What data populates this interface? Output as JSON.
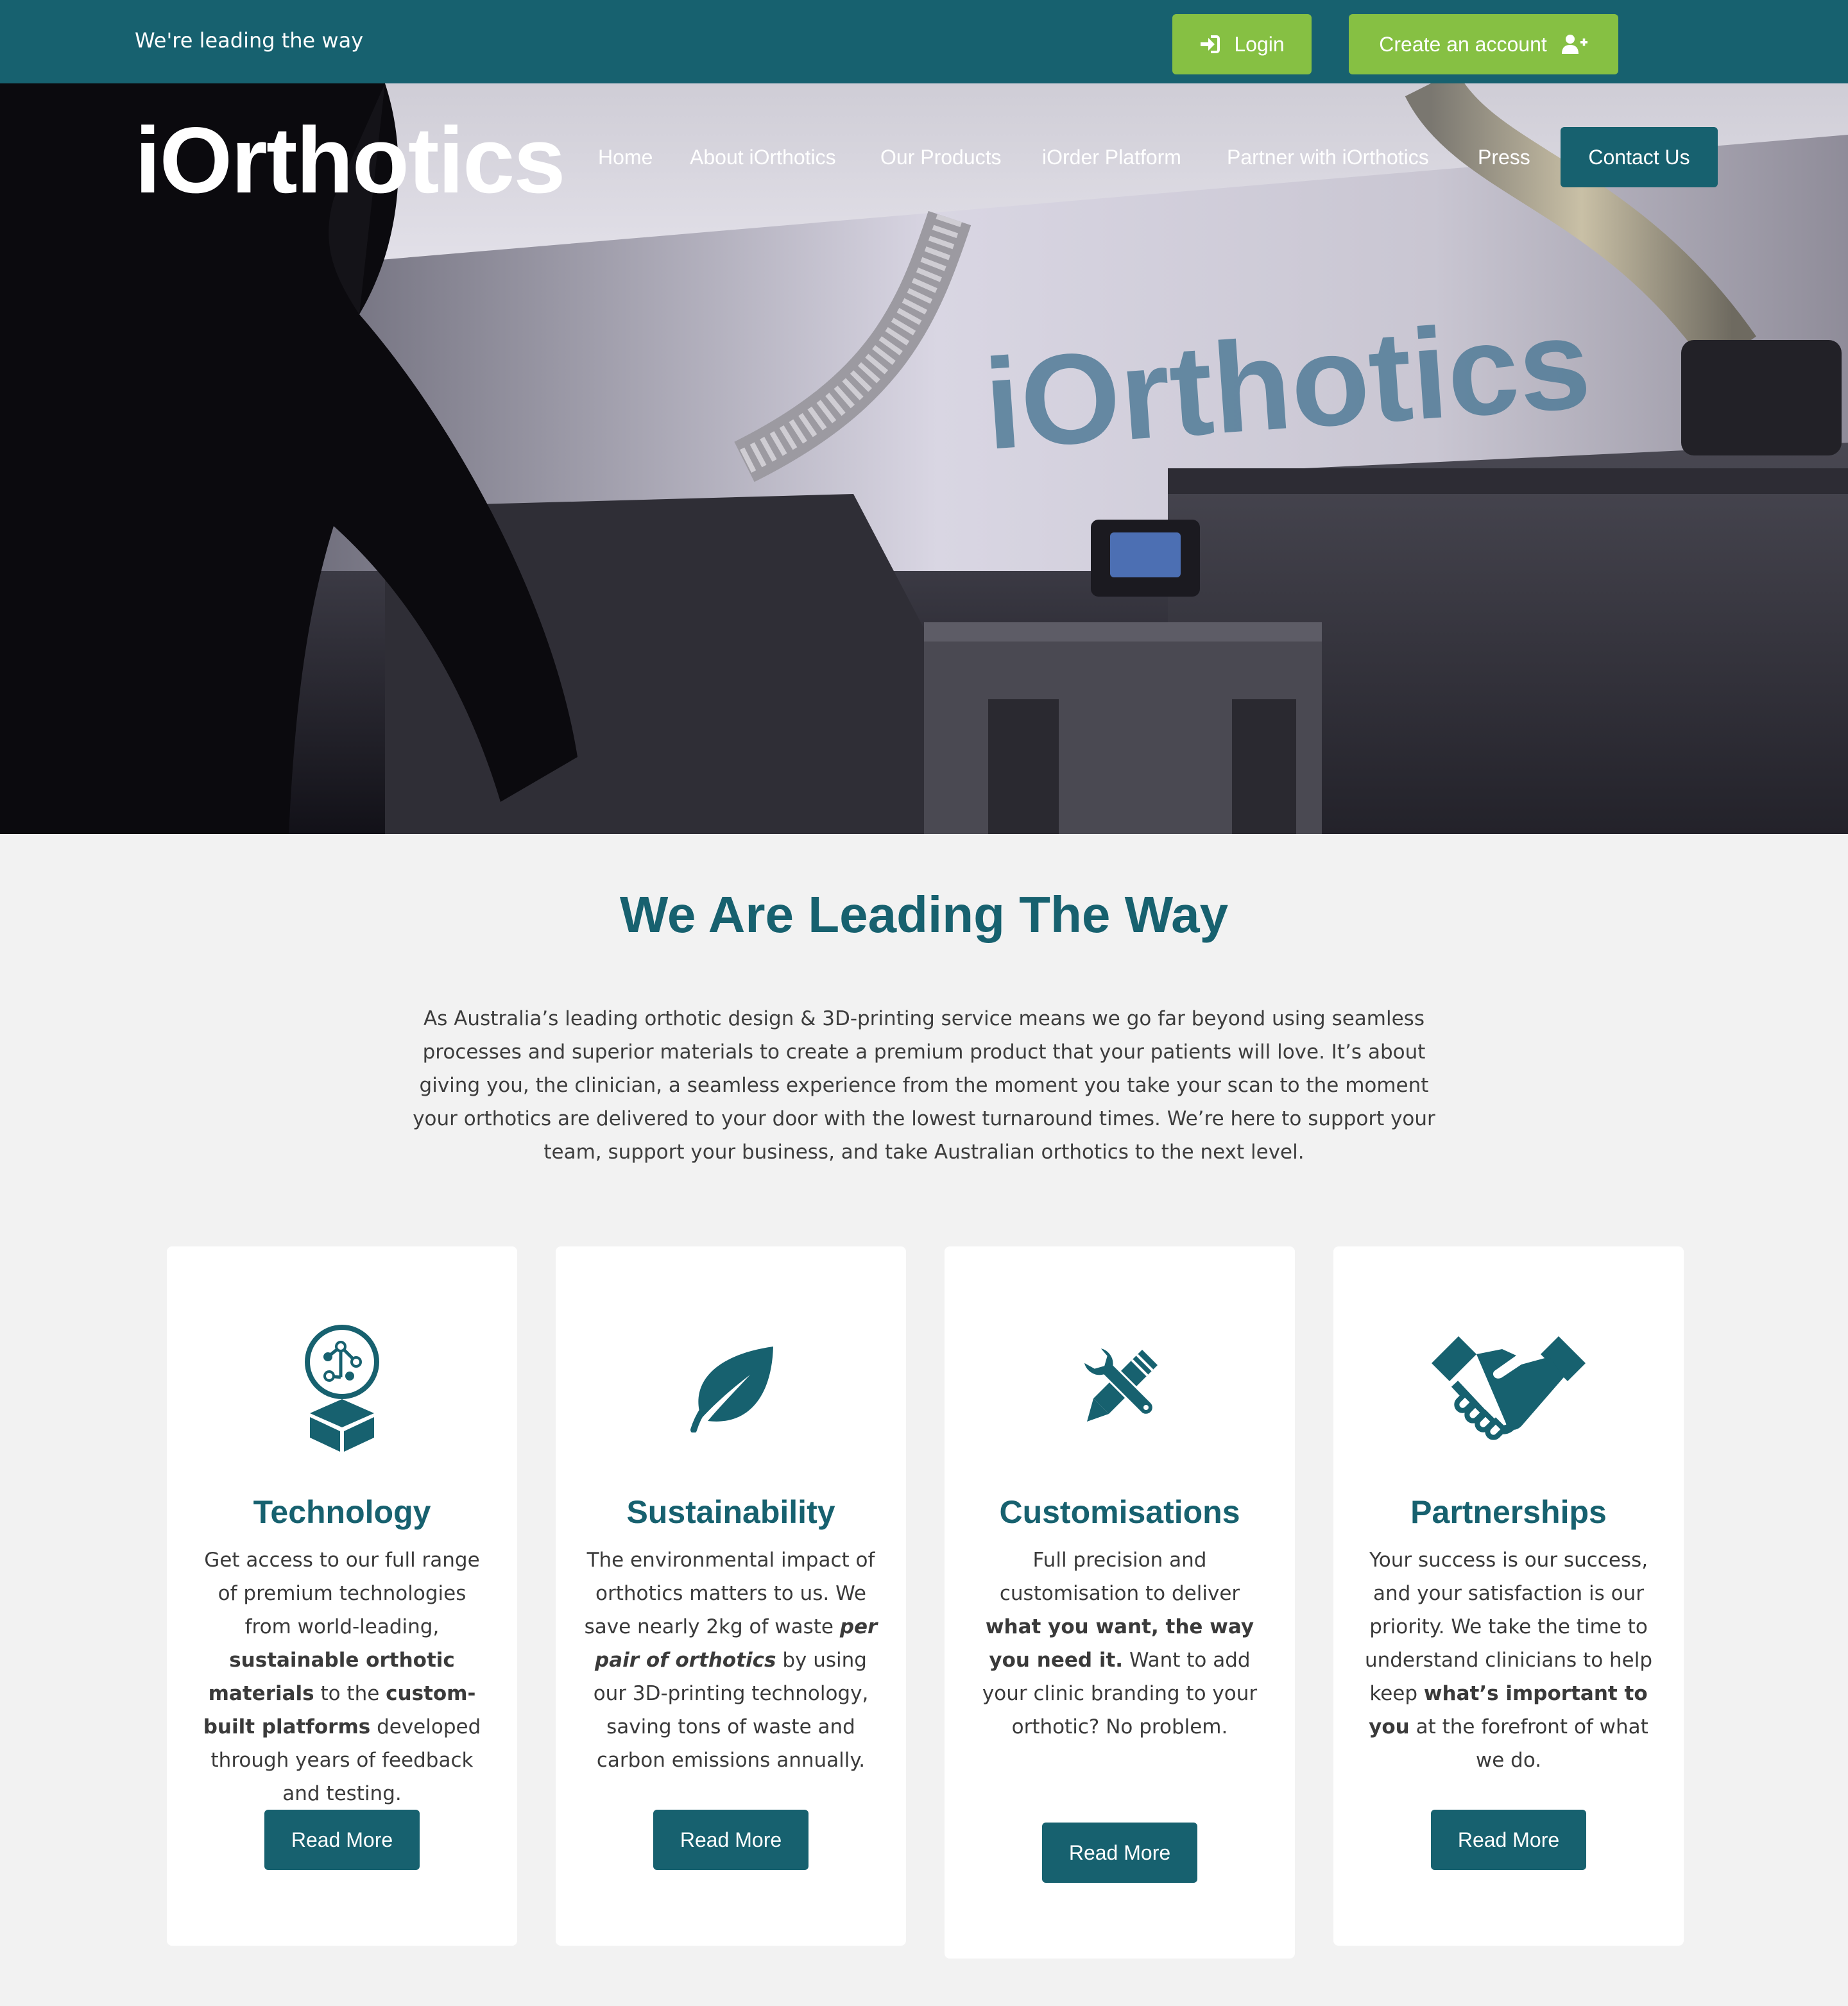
{
  "topbar": {
    "tagline": "We're leading the way",
    "login_label": "Login",
    "create_account_label": "Create an account"
  },
  "brand": {
    "logo_text": "iOrthotics",
    "wall_sign_text": "iOrthotics",
    "accent": "#86c043",
    "primary": "#17616f"
  },
  "nav": {
    "items": [
      "Home",
      "About iOrthotics",
      "Our Products",
      "iOrder Platform",
      "Partner with iOrthotics",
      "Press"
    ],
    "contact_label": "Contact Us"
  },
  "intro": {
    "title": "We Are Leading The Way",
    "text": "As Australia’s leading orthotic design & 3D-printing service means we go far beyond using seamless processes and superior materials to create a premium product that your patients will love. It’s about giving you, the clinician, a seamless experience from the moment you take your scan to the moment your orthotics are delivered to your door with the lowest turnaround times. We’re here to support your team, support your business, and take Australian orthotics to the next level."
  },
  "cards": [
    {
      "icon": "technology-icon",
      "title": "Technology",
      "parts": [
        {
          "t": "Get access to our full range of premium technologies from world-leading, "
        },
        {
          "t": "sustainable orthotic materials",
          "b": true
        },
        {
          "t": " to the "
        },
        {
          "t": "custom-built platforms",
          "b": true
        },
        {
          "t": " developed through years of feedback and testing."
        }
      ],
      "button": "Read More"
    },
    {
      "icon": "leaf-icon",
      "title": "Sustainability",
      "parts": [
        {
          "t": "The environmental impact of orthotics matters to us. We save nearly 2kg of waste "
        },
        {
          "t": "per pair of orthotics",
          "i": true
        },
        {
          "t": " by using our 3D-printing technology, saving tons of waste and carbon emissions annually."
        }
      ],
      "button": "Read More"
    },
    {
      "icon": "tools-icon",
      "title": "Customisations",
      "parts": [
        {
          "t": "Full precision and customisation to deliver "
        },
        {
          "t": "what you want, the way you need it.",
          "b": true
        },
        {
          "t": " Want to add your clinic branding to your orthotic? No problem."
        }
      ],
      "button": "Read More"
    },
    {
      "icon": "handshake-icon",
      "title": "Partnerships",
      "parts": [
        {
          "t": "Your success is our success, and your satisfaction is our priority. We take the time to understand clinicians to help keep "
        },
        {
          "t": "what’s important to you",
          "b": true
        },
        {
          "t": " at the forefront of what we do."
        }
      ],
      "button": "Read More"
    }
  ]
}
